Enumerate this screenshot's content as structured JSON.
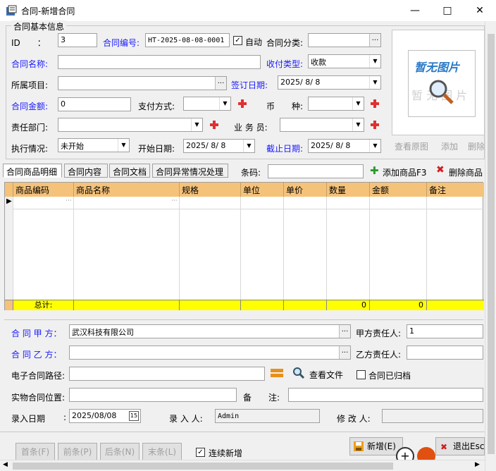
{
  "window": {
    "title": "合同-新增合同"
  },
  "group": {
    "title": "合同基本信息"
  },
  "fields": {
    "id_label": "ID　　：",
    "id_value": "3",
    "contract_no_label": "合同编号:",
    "contract_no_value": "HT-2025-08-08-0001",
    "auto_label": "自动",
    "category_label": "合同分类:",
    "category_value": "",
    "name_label": "合同名称:",
    "name_value": "",
    "pay_type_label": "收付类型:",
    "pay_type_value": "收款",
    "project_label": "所属项目:",
    "project_value": "",
    "sign_date_label": "签订日期:",
    "sign_date_value": "2025/ 8/ 8",
    "amount_label": "合同金额:",
    "amount_value": "0",
    "pay_method_label": "支付方式:",
    "pay_method_value": "",
    "currency_label": "币　　种:",
    "currency_value": "",
    "dept_label": "责任部门:",
    "dept_value": "",
    "salesman_label": "业 务 员:",
    "salesman_value": "",
    "status_label": "执行情况:",
    "status_value": "未开始",
    "start_date_label": "开始日期:",
    "start_date_value": "2025/ 8/ 8",
    "end_date_label": "截止日期:",
    "end_date_value": "2025/ 8/ 8"
  },
  "image": {
    "placeholder_line1": "暂无图片",
    "placeholder_line2": "暂 无 图 片",
    "view_label": "查看原图",
    "add_label": "添加",
    "delete_label": "删除"
  },
  "tabs": [
    "合同商品明细",
    "合同内容",
    "合同文档",
    "合同异常情况处理"
  ],
  "barcode": {
    "label": "条码:",
    "value": ""
  },
  "actions": {
    "add_goods": "添加商品F3",
    "delete_goods": "删除商品"
  },
  "grid": {
    "columns": [
      "商品编码",
      "商品名称",
      "规格",
      "单位",
      "单价",
      "数量",
      "金额",
      "备注"
    ],
    "total_label": "总计:",
    "total_qty": "0",
    "total_amount": "0"
  },
  "party": {
    "a_label": "合 同 甲 方：",
    "a_value": "武汉科技有限公司",
    "a_person_label": "甲方责任人:",
    "a_person_value": "1",
    "b_label": "合 同 乙 方：",
    "b_value": "",
    "b_person_label": "乙方责任人:",
    "b_person_value": "",
    "path_label": "电子合同路径:",
    "path_value": "",
    "view_file_label": "查看文件",
    "archived_label": "合同已归档",
    "location_label": "实物合同位置:",
    "location_value": "",
    "remark_label": "备　　注:",
    "remark_value": "",
    "entry_date_label": "录入日期",
    "entry_date_value": "2025/08/08",
    "entry_user_label": "录 入 人:",
    "entry_user_value": "Admin",
    "modifier_label": "修 改 人:",
    "modifier_value": ""
  },
  "footer": {
    "first": "首条(F)",
    "prev": "前条(P)",
    "next": "后条(N)",
    "last": "末条(L)",
    "continuous": "连续新增",
    "new": "新增(E)",
    "exit": "退出Esc"
  },
  "colors": {
    "accent_blue": "#1a1aff",
    "header_orange": "#f5c27a",
    "total_yellow": "#ffff00",
    "plus_red": "#e03030"
  }
}
